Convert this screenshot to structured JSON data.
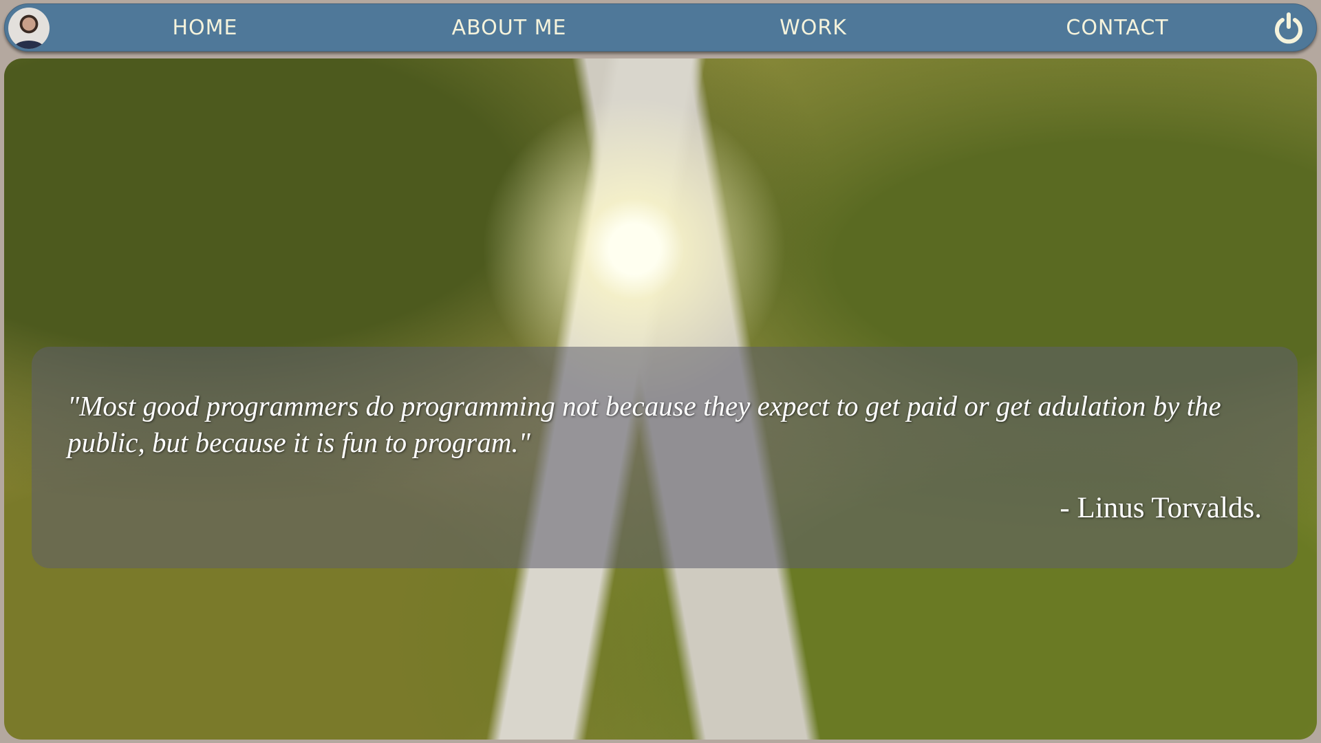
{
  "nav": {
    "items": [
      {
        "label": "HOME"
      },
      {
        "label": "ABOUT ME"
      },
      {
        "label": "WORK"
      },
      {
        "label": "CONTACT"
      }
    ],
    "avatar_icon": "profile-photo",
    "power_icon": "power-icon"
  },
  "quote": {
    "text": "\"Most good programmers do programming not because they expect to get paid or get adulation by the public, but because it is fun to program.\"",
    "author": "- Linus Torvalds."
  },
  "colors": {
    "nav": "#4f7899",
    "nav_text": "#f5f3dc",
    "page_bg": "#b4a89f"
  }
}
